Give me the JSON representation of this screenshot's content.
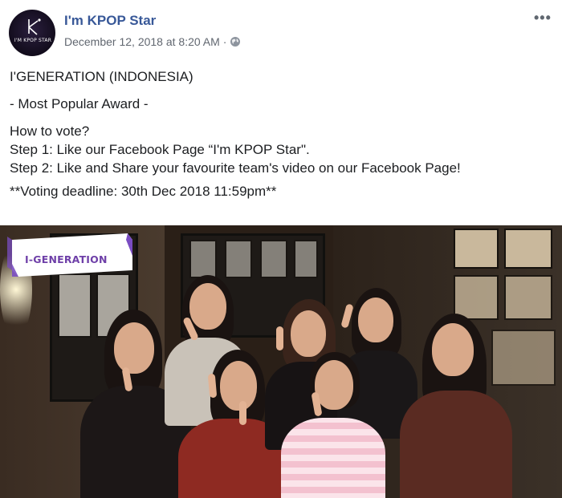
{
  "post": {
    "page_name": "I'm KPOP Star",
    "avatar_text": "I'M KPOP STAR",
    "timestamp": "December 12, 2018 at 8:20 AM",
    "separator": "·",
    "privacy_icon": "globe-icon",
    "more_icon": "more-options-icon",
    "more_glyph": "•••"
  },
  "body": {
    "lines": [
      "I'GENERATION (INDONESIA)",
      "- Most Popular Award -",
      "How to vote?",
      "Step 1: Like our Facebook Page “I'm KPOP Star\".",
      "Step 2: Like and Share your favourite team's video on our Facebook Page!",
      "**Voting deadline: 30th Dec 2018 11:59pm**"
    ]
  },
  "video": {
    "badge_label": "I-GENERATION"
  },
  "colors": {
    "link": "#385898",
    "meta": "#616770",
    "badge_text": "#6e3fa8",
    "badge_accent": "#7a4cc2"
  }
}
